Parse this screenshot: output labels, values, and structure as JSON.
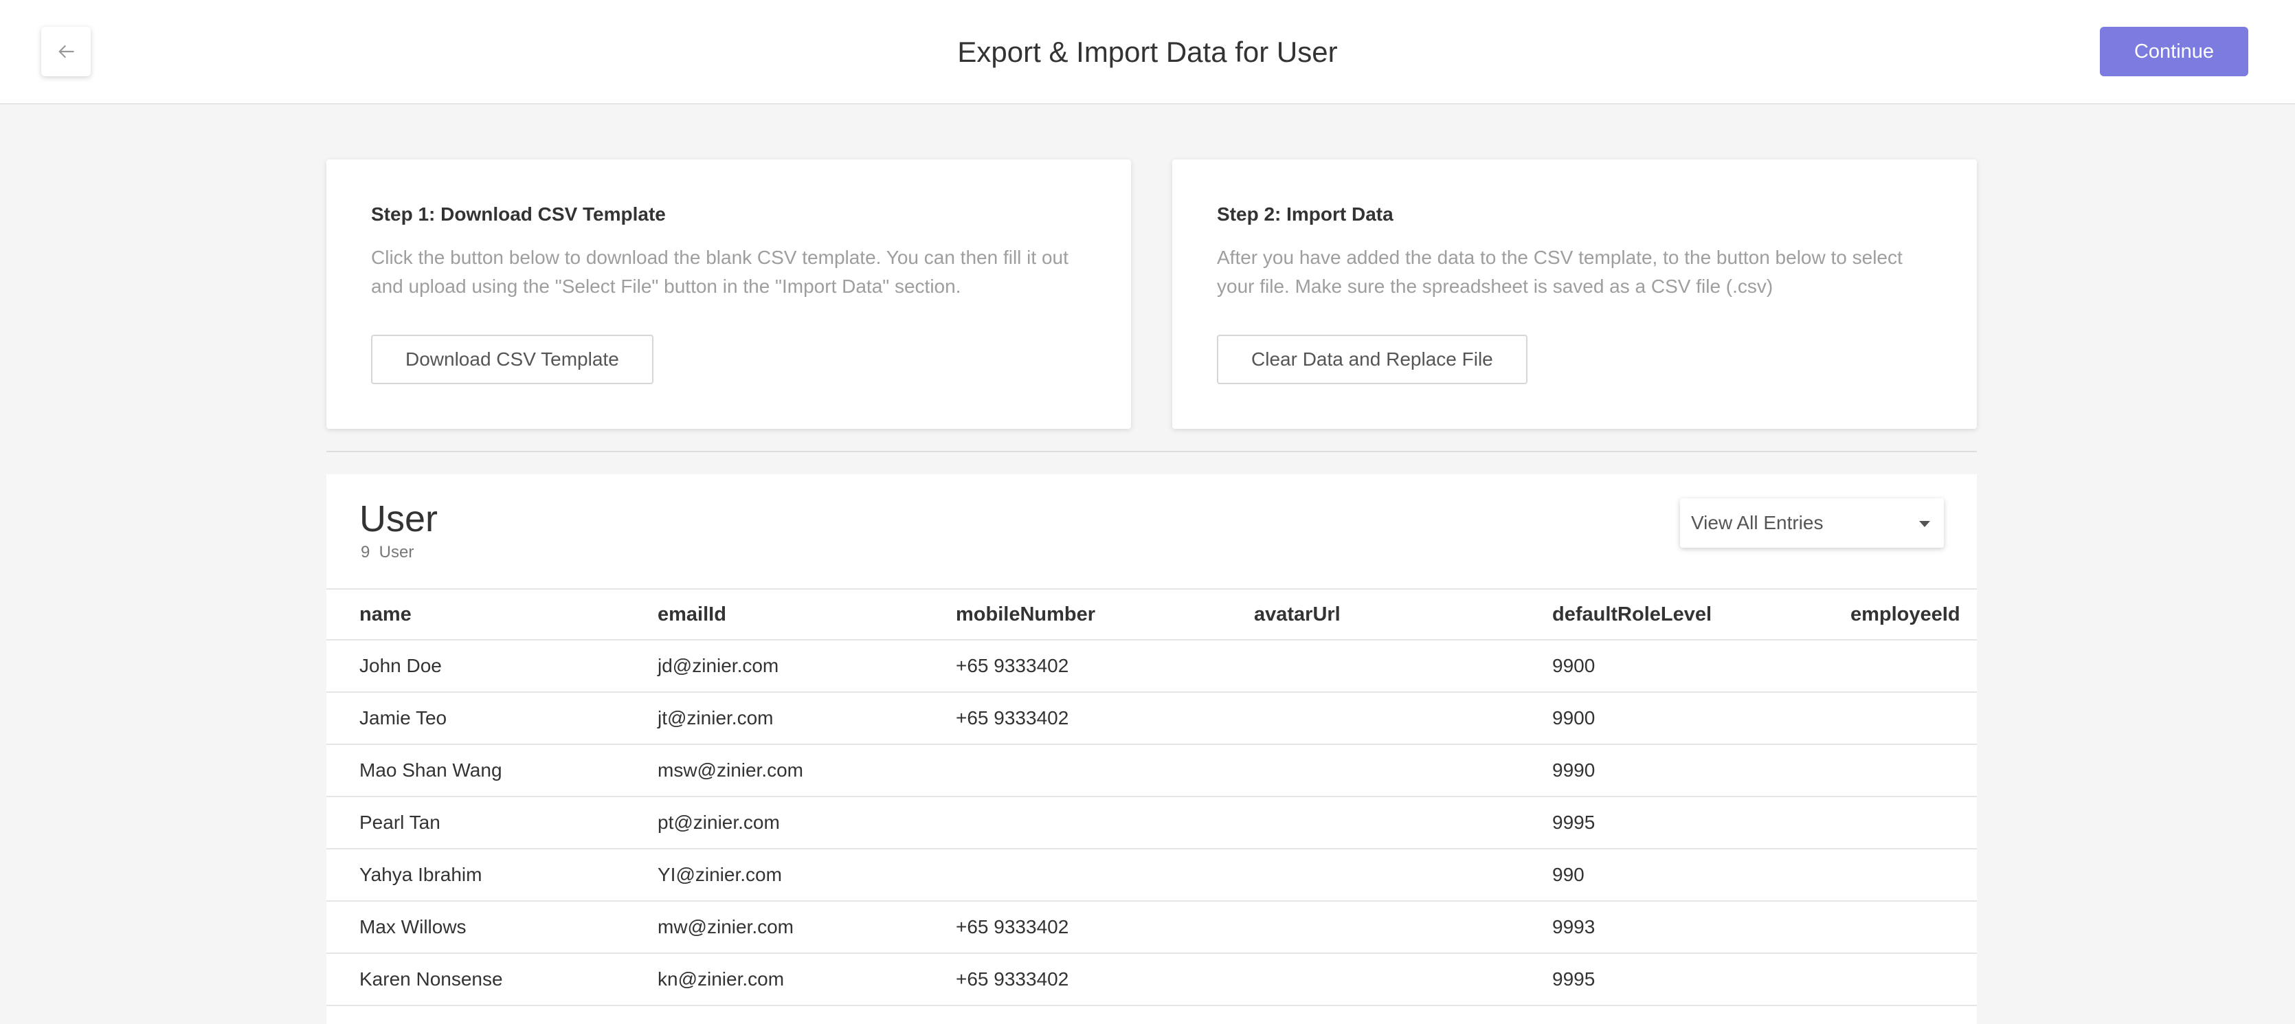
{
  "header": {
    "title": "Export & Import Data for User",
    "continue_label": "Continue"
  },
  "step1": {
    "title": "Step 1: Download CSV Template",
    "description": "Click the button below to download the blank CSV template. You can then fill it out and upload using the \"Select File\" button in the \"Import Data\" section.",
    "button_label": "Download CSV Template"
  },
  "step2": {
    "title": "Step 2: Import Data",
    "description": "After you have added the data to the CSV template, to the button below to select your file. Make sure the spreadsheet is saved as a CSV file (.csv)",
    "button_label": "Clear Data and Replace File"
  },
  "entity": {
    "title": "User",
    "count": "9  User",
    "view_select": "View All Entries"
  },
  "table": {
    "columns": [
      "name",
      "emailId",
      "mobileNumber",
      "avatarUrl",
      "defaultRoleLevel",
      "employeeId"
    ],
    "rows": [
      [
        "John Doe",
        "jd@zinier.com",
        "+65 9333402",
        "",
        "9900",
        ""
      ],
      [
        "Jamie Teo",
        "jt@zinier.com",
        "+65 9333402",
        "",
        "9900",
        ""
      ],
      [
        "Mao Shan Wang",
        "msw@zinier.com",
        "",
        "",
        "9990",
        ""
      ],
      [
        "Pearl Tan",
        "pt@zinier.com",
        "",
        "",
        "9995",
        ""
      ],
      [
        "Yahya Ibrahim",
        "YI@zinier.com",
        "",
        "",
        "990",
        ""
      ],
      [
        "Max Willows",
        "mw@zinier.com",
        "+65 9333402",
        "",
        "9993",
        ""
      ],
      [
        "Karen Nonsense",
        "kn@zinier.com",
        "+65 9333402",
        "",
        "9995",
        ""
      ]
    ]
  },
  "icons": {
    "back": "arrow-left-icon",
    "dropdown": "caret-down-icon"
  },
  "colors": {
    "accent": "#7b7be0",
    "background": "#f5f5f5"
  }
}
